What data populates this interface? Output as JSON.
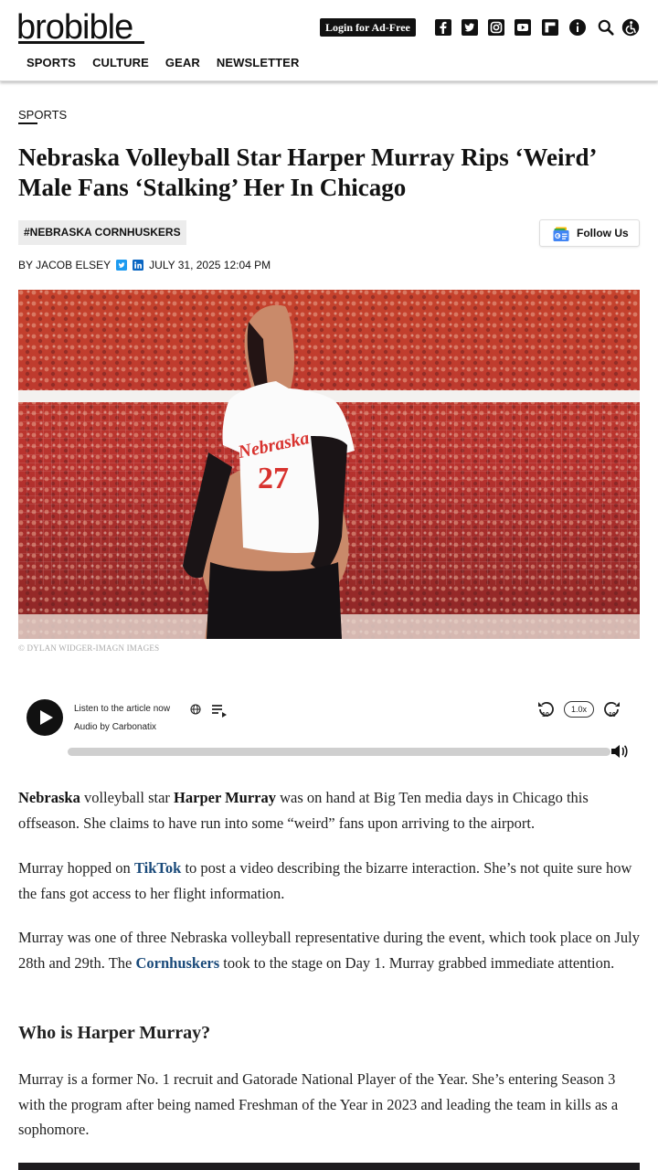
{
  "header": {
    "logo": "brobible",
    "login_label": "Login for Ad-Free",
    "social_icons": [
      "facebook-icon",
      "twitter-icon",
      "instagram-icon",
      "youtube-icon",
      "flipboard-icon",
      "info-icon",
      "search-icon",
      "accessibility-icon"
    ],
    "nav": [
      "SPORTS",
      "CULTURE",
      "GEAR",
      "NEWSLETTER"
    ]
  },
  "article": {
    "category": "SPORTS",
    "title": "Nebraska Volleyball Star Harper Murray Rips ‘Weird’ Male Fans ‘Stalking’ Her In Chicago",
    "tag": "#NEBRASKA CORNHUSKERS",
    "follow_label": "Follow Us",
    "byline": "BY JACOB ELSEY",
    "date": "JULY 31, 2025 12:04 PM",
    "image_credit": "© DYLAN WIDGER-IMAGN IMAGES"
  },
  "player": {
    "listen_label": "Listen to the article now",
    "audio_by": "Audio by Carbonatix",
    "speed": "1.0x"
  },
  "body": {
    "p1": [
      {
        "t": "Nebraska",
        "s": "b"
      },
      {
        "t": " volleyball star ",
        "s": ""
      },
      {
        "t": "Harper Murray",
        "s": "b"
      },
      {
        "t": " was on hand at Big Ten media days in Chicago this offseason. She claims to have run into some “weird” fans upon arriving to the airport.",
        "s": ""
      }
    ],
    "p2": [
      {
        "t": "Murray hopped on ",
        "s": ""
      },
      {
        "t": "TikTok",
        "s": "a"
      },
      {
        "t": " to post a video describing the bizarre interaction. She’s not quite sure how the fans got access to her flight information.",
        "s": ""
      }
    ],
    "p3": [
      {
        "t": "Murray was one of three Nebraska volleyball representative during the event, which took place on July 28th and 29th. The ",
        "s": ""
      },
      {
        "t": "Cornhuskers",
        "s": "a"
      },
      {
        "t": " took to the stage on Day 1. Murray grabbed immediate attention.",
        "s": ""
      }
    ],
    "h2": "Who is Harper Murray?",
    "p4": [
      {
        "t": "Murray is a former No. 1 recruit and Gatorade National Player of the Year. She’s entering Season 3 with the program after being named Freshman of the Year in 2023 and leading the team in kills as a sophomore.",
        "s": ""
      }
    ]
  }
}
